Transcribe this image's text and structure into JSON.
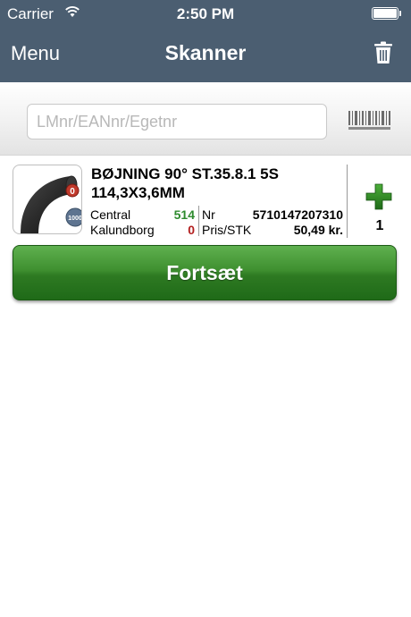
{
  "status_bar": {
    "carrier": "Carrier",
    "time": "2:50 PM"
  },
  "header": {
    "menu_label": "Menu",
    "title": "Skanner",
    "trash_icon": "trash-icon",
    "background_color": "#4b5e71"
  },
  "search": {
    "placeholder": "LMnr/EANnr/Egetnr",
    "value": "",
    "barcode_icon": "barcode-icon"
  },
  "product": {
    "name": "BØJNING 90° ST.35.8.1 5S 114,3X3,6MM",
    "badge_top": "0",
    "badge_bottom": "1000",
    "stock": [
      {
        "location": "Central",
        "quantity": "514",
        "color": "#2e8b2e"
      },
      {
        "location": "Kalundborg",
        "quantity": "0",
        "color": "#b31f1f"
      }
    ],
    "nr_label": "Nr",
    "nr_value": "5710147207310",
    "price_label": "Pris/STK",
    "price_value": "50,49 kr.",
    "quantity": "1",
    "add_icon": "plus-icon"
  },
  "continue_label": "Fortsæt",
  "accent_green": "#3f9030"
}
